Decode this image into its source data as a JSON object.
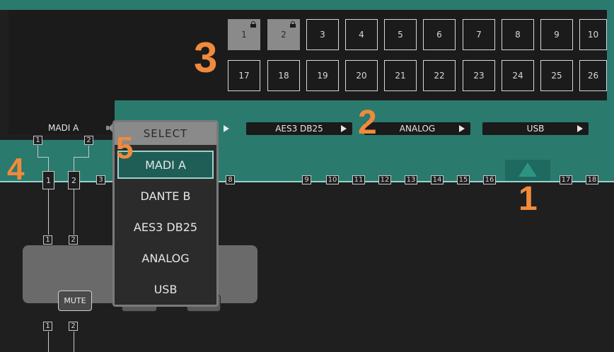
{
  "grid": {
    "row1": [
      {
        "label": "1",
        "locked": true
      },
      {
        "label": "2",
        "locked": true
      },
      {
        "label": "3"
      },
      {
        "label": "4"
      },
      {
        "label": "5"
      },
      {
        "label": "6"
      },
      {
        "label": "7"
      },
      {
        "label": "8"
      },
      {
        "label": "9"
      },
      {
        "label": "10"
      }
    ],
    "row2": [
      {
        "label": "17"
      },
      {
        "label": "18"
      },
      {
        "label": "19"
      },
      {
        "label": "20"
      },
      {
        "label": "21"
      },
      {
        "label": "22"
      },
      {
        "label": "23"
      },
      {
        "label": "24"
      },
      {
        "label": "25"
      },
      {
        "label": "26"
      }
    ]
  },
  "sources": {
    "madi_a": "MADI A",
    "aes3": "AES3 DB25",
    "analog": "ANALOG",
    "usb": "USB"
  },
  "dropdown": {
    "header": "SELECT",
    "items": [
      "MADI A",
      "DANTE B",
      "AES3 DB25",
      "ANALOG",
      "USB"
    ],
    "selected_index": 0
  },
  "channel_strip": {
    "top_pair": [
      "1",
      "2"
    ],
    "main_pair": [
      "1",
      "2",
      "3"
    ],
    "right_channels": [
      "8",
      "9",
      "10",
      "11",
      "12",
      "13",
      "14",
      "15",
      "16",
      "17",
      "18"
    ],
    "mid_pair": [
      "1",
      "2"
    ],
    "bottom_pair": [
      "1",
      "2"
    ]
  },
  "panel": {
    "mute_label": "MUTE"
  },
  "callouts": [
    "1",
    "2",
    "3",
    "4",
    "5"
  ],
  "icons": {
    "lock": "lock-icon",
    "speaker": "speaker-icon",
    "play": "play-triangle-icon",
    "up": "up-arrow-icon"
  },
  "colors": {
    "teal": "#2a7a6e",
    "teal_highlight": "#1e5e57",
    "callout": "#f08a3c",
    "background": "#1f1f1f"
  }
}
